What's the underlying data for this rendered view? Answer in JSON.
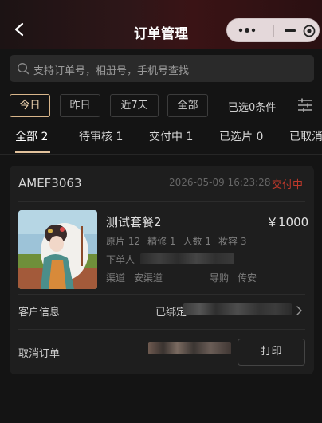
{
  "header": {
    "title": "订单管理"
  },
  "search": {
    "placeholder": "支持订单号，相册号，手机号查找"
  },
  "filters": {
    "chips": [
      "今日",
      "昨日",
      "近7天",
      "全部"
    ],
    "selected_text": "已选0条件"
  },
  "tabs": [
    "全部 2",
    "待审核 1",
    "交付中 1",
    "已选片 0",
    "已取消"
  ],
  "order": {
    "id": "AMEF3063",
    "time": "2026-05-09 16:23:28",
    "status": "交付中",
    "package_name": "测试套餐2",
    "price": "￥1000",
    "attrs": [
      "原片 12",
      "精修 1",
      "人数 1",
      "妆容 3"
    ],
    "orderer_label": "下单人",
    "channel_label": "渠道",
    "channel_value": "安渠道",
    "guide_label": "导购",
    "guide_value": "传安",
    "customer_label": "客户信息",
    "bound_text": "已绑定",
    "cancel_label": "取消订单",
    "print_label": "打印"
  },
  "colors": {
    "accent": "#e2c29c",
    "status": "#c0392b",
    "background": "#141414",
    "card": "#1e1e1e"
  }
}
